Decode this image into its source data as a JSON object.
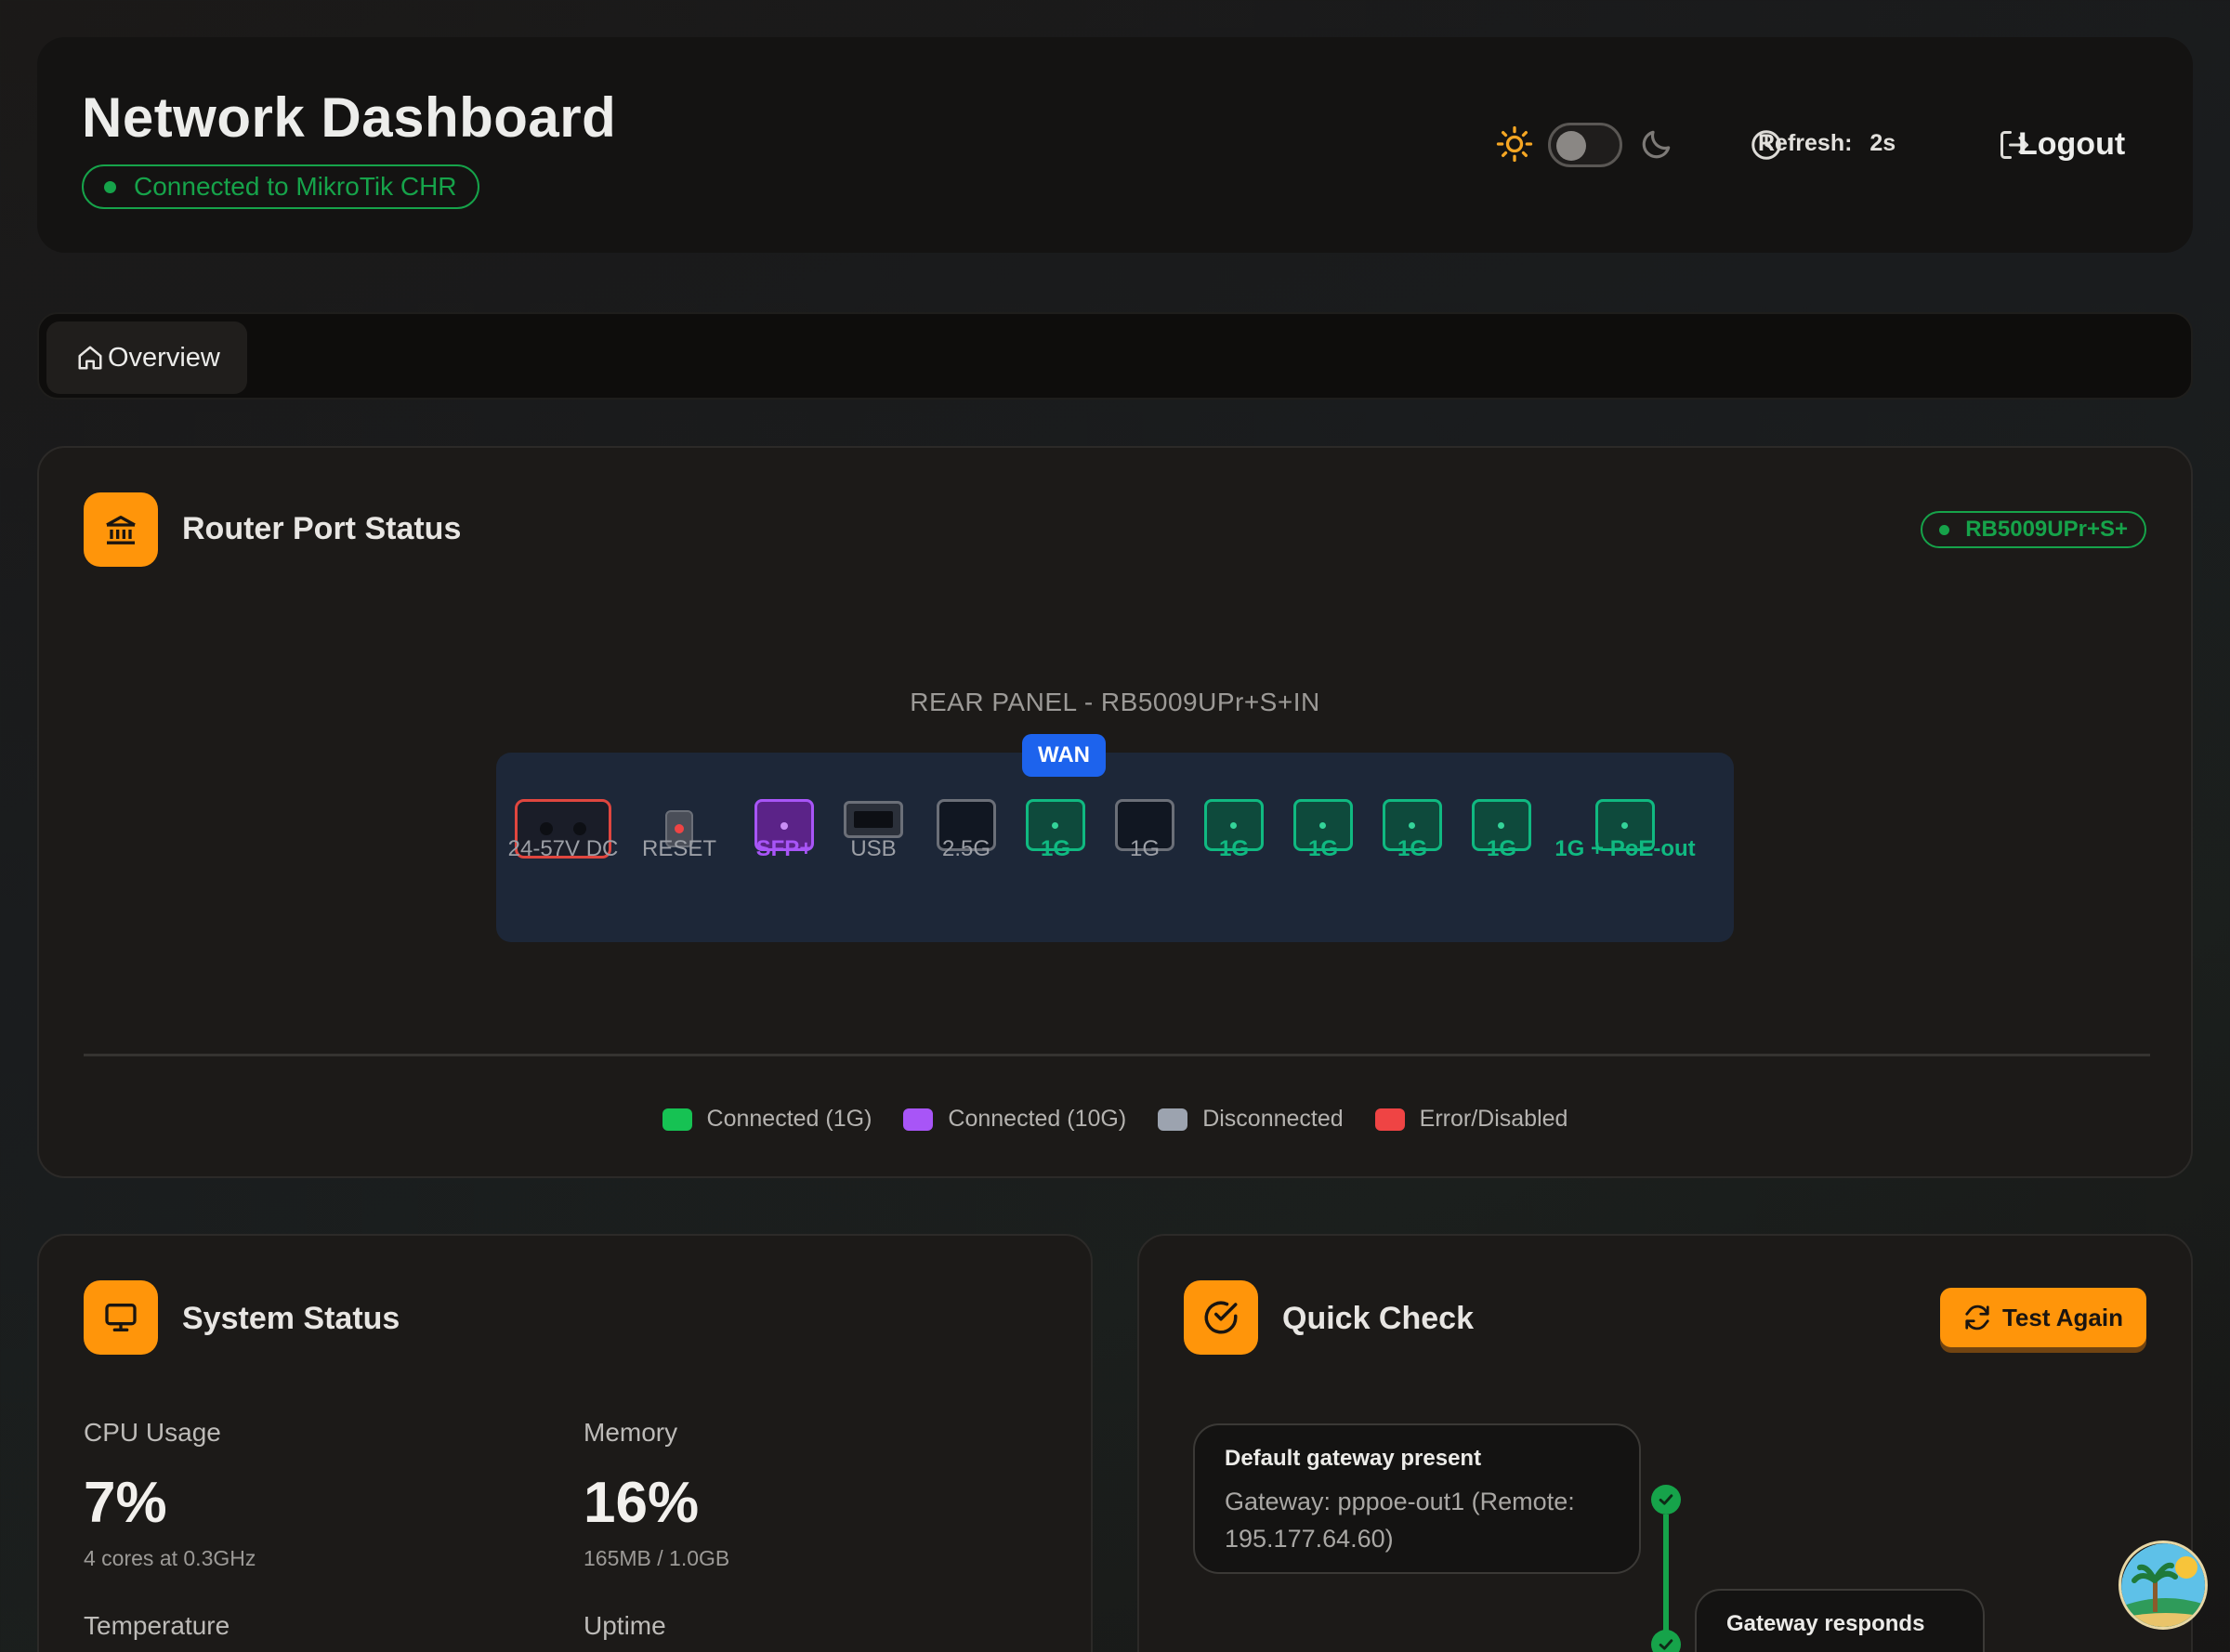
{
  "header": {
    "title": "Network Dashboard",
    "connection_prefix": "Connected to",
    "connection_target": "MikroTik CHR",
    "refresh_label": "Refresh:",
    "refresh_value": "2s",
    "logout_label": "Logout"
  },
  "tabs": [
    {
      "label": "Overview",
      "icon": "home-icon",
      "active": true
    }
  ],
  "router_ports": {
    "title": "Router Port Status",
    "model_badge": "RB5009UPr+S+",
    "panel_title": "REAR PANEL - RB5009UPr+S+IN",
    "wan_badge": "WAN",
    "ports": [
      {
        "label": "24-57V DC",
        "status": "error"
      },
      {
        "label": "RESET",
        "status": "reset"
      },
      {
        "label": "SFP+",
        "status": "connected-10g"
      },
      {
        "label": "USB",
        "status": "disconnected"
      },
      {
        "label": "2.5G",
        "status": "disconnected"
      },
      {
        "label": "1G",
        "status": "connected-1g",
        "wan": true
      },
      {
        "label": "1G",
        "status": "disconnected"
      },
      {
        "label": "1G",
        "status": "connected-1g"
      },
      {
        "label": "1G",
        "status": "connected-1g"
      },
      {
        "label": "1G",
        "status": "connected-1g"
      },
      {
        "label": "1G",
        "status": "connected-1g"
      },
      {
        "label": "1G + PoE-out",
        "status": "connected-1g"
      }
    ],
    "legend": [
      {
        "label": "Connected (1G)",
        "color": "#16c253"
      },
      {
        "label": "Connected (10G)",
        "color": "#a855f7"
      },
      {
        "label": "Disconnected",
        "color": "#9ca3af"
      },
      {
        "label": "Error/Disabled",
        "color": "#ef4444"
      }
    ]
  },
  "system_status": {
    "title": "System Status",
    "cpu_label": "CPU Usage",
    "cpu_value": "7%",
    "cpu_sub": "4 cores at 0.3GHz",
    "memory_label": "Memory",
    "memory_value": "16%",
    "memory_sub": "165MB / 1.0GB",
    "temperature_label": "Temperature",
    "uptime_label": "Uptime"
  },
  "quick_check": {
    "title": "Quick Check",
    "test_button": "Test Again",
    "checks": [
      {
        "title": "Default gateway present",
        "detail": "Gateway: pppoe-out1 (Remote: 195.177.64.60)",
        "status": "pass"
      },
      {
        "title": "Gateway responds",
        "detail": "",
        "status": "pass"
      }
    ]
  },
  "colors": {
    "accent": "#ff950a",
    "success": "#16a34a",
    "wan": "#1d63ed"
  }
}
